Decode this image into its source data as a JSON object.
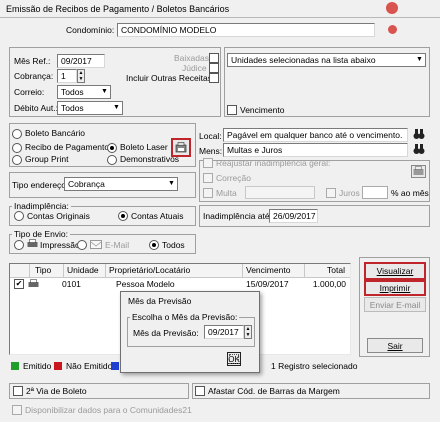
{
  "window": {
    "title": "Emissão de Recibos de Pagamento / Boletos Bancários"
  },
  "condominio": {
    "label": "Condomínio:",
    "value": "CONDOMÍNIO MODELO"
  },
  "filters": {
    "mes_ref_label": "Mês Ref.:",
    "mes_ref_value": "09/2017",
    "cobranca_label": "Cobrança:",
    "cobranca_value": "1",
    "correio_label": "Correio:",
    "correio_value": "Todos",
    "debito_label": "Débito Aut.:",
    "debito_value": "Todos",
    "baixadas_label": "Baixadas",
    "judice_label": "Júdice",
    "outras_receitas_label": "Incluir Outras Receitas",
    "unidades_value": "Unidades selecionadas na lista abaixo",
    "vencimento_label": "Vencimento"
  },
  "tipo": {
    "boleto_bancario": "Boleto Bancário",
    "recibo_pagamento": "Recibo de Pagamento",
    "boleto_laser": "Boleto Laser",
    "group_print": "Group Print",
    "demonstrativos": "Demonstrativos"
  },
  "local": {
    "label": "Local:",
    "value": "Pagável em qualquer banco até o vencimento."
  },
  "mens": {
    "label": "Mens:",
    "value": "Multas e Juros"
  },
  "reajustar": {
    "label": "Reajustar inadimplência geral:",
    "correcao": "Correção",
    "multa": "Multa",
    "juros": "Juros",
    "ao_mes": "% ao mês"
  },
  "endereco": {
    "label": "Tipo endereço:",
    "value": "Cobrança"
  },
  "inadimplencia": {
    "group": "Inadimplência:",
    "contas_originais": "Contas Originais",
    "contas_atuais": "Contas Atuais",
    "ate_label": "Inadimplência até:",
    "ate_value": "26/09/2017"
  },
  "envio": {
    "group": "Tipo de Envio:",
    "impressao": "Impressão",
    "email": "E-Mail",
    "todos": "Todos"
  },
  "table": {
    "columns": [
      "Tipo",
      "Unidade",
      "Proprietário/Locatário",
      "Vencimento",
      "Total"
    ],
    "rows": [
      {
        "unidade": "0101",
        "proprietario": "Pessoa Modelo",
        "vencimento": "15/09/2017",
        "total": "1.000,00"
      }
    ],
    "count_text": "1 Registro selecionado"
  },
  "buttons": {
    "visualizar": "Visualizar",
    "imprimir": "Imprimir",
    "enviar_email": "Enviar E-mail",
    "sair": "Sair"
  },
  "legend": {
    "emitido": "Emitido",
    "nao_emitido": "Não Emitido",
    "emitido_color": "#1f9e2c",
    "nao_emitido_color": "#c8171e",
    "third_color": "#1f3fd0"
  },
  "footer": {
    "segunda_via": "2ª Via de Boleto",
    "afastar": "Afastar Cód. de Barras da Margem",
    "disponibilizar": "Disponibilizar dados para o Comunidades21"
  },
  "dialog": {
    "title": "Mês da Previsão",
    "group": "Escolha o Mês da Previsão:",
    "label": "Mês da Previsão:",
    "value": "09/2017",
    "ok": "OK"
  }
}
